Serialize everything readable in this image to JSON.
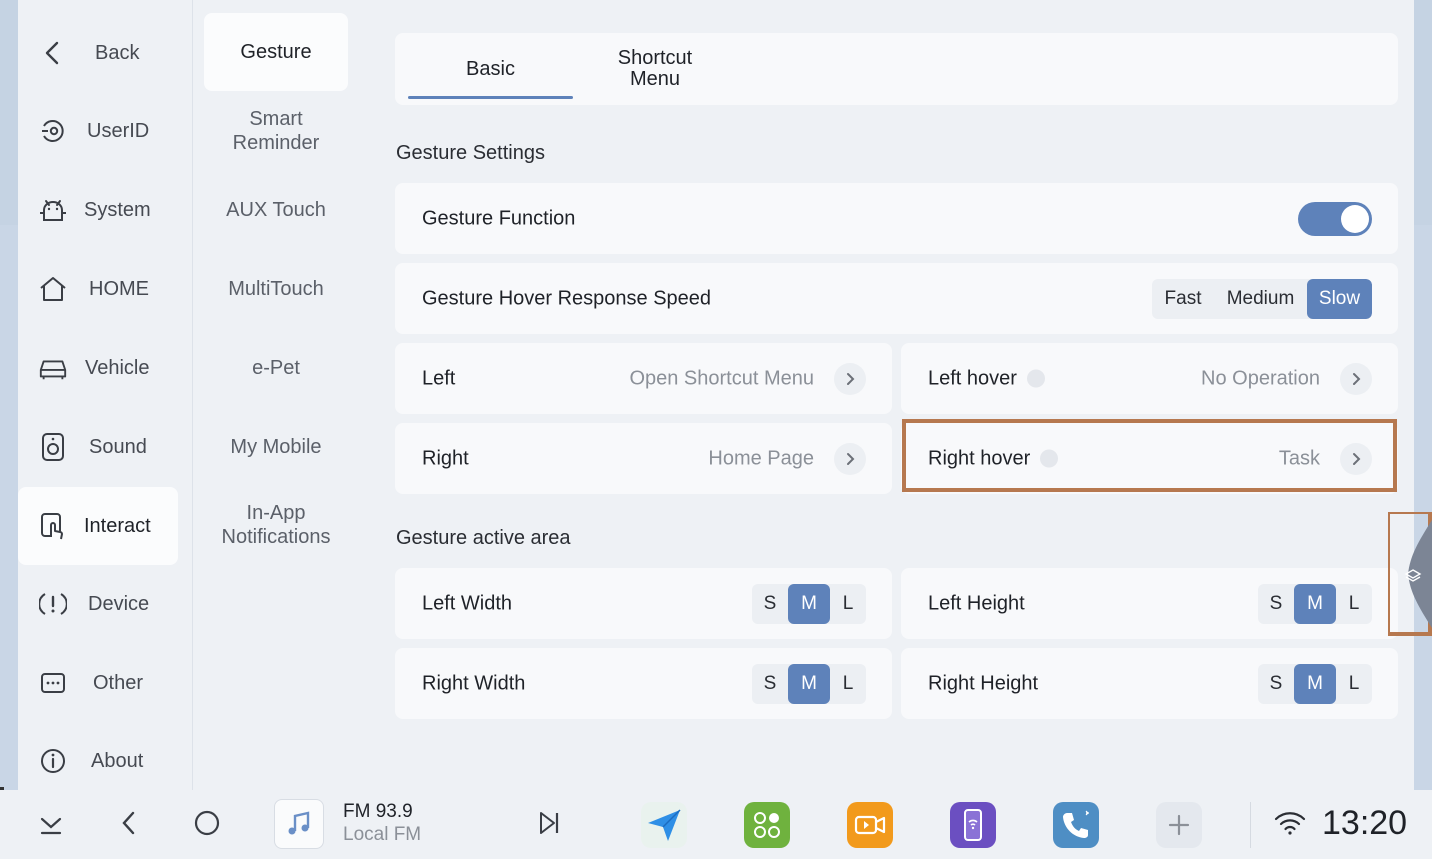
{
  "nav": {
    "back_label": "Back",
    "items": [
      {
        "label": "UserID",
        "icon": "user-id-icon"
      },
      {
        "label": "System",
        "icon": "android-icon"
      },
      {
        "label": "HOME",
        "icon": "home-icon"
      },
      {
        "label": "Vehicle",
        "icon": "car-icon"
      },
      {
        "label": "Sound",
        "icon": "speaker-icon"
      },
      {
        "label": "Interact",
        "icon": "touch-icon"
      },
      {
        "label": "Device",
        "icon": "device-alert-icon"
      },
      {
        "label": "Other",
        "icon": "more-icon"
      },
      {
        "label": "About",
        "icon": "info-icon"
      }
    ],
    "active": "Interact"
  },
  "subnav": {
    "items": [
      "Gesture",
      "Smart\nReminder",
      "AUX Touch",
      "MultiTouch",
      "e-Pet",
      "My Mobile",
      "In-App\nNotifications"
    ],
    "active": "Gesture"
  },
  "tabs": {
    "basic": "Basic",
    "shortcut_line1": "Shortcut",
    "shortcut_line2": "Menu",
    "active": "Basic"
  },
  "gesture_settings": {
    "title": "Gesture Settings",
    "function_label": "Gesture Function",
    "function_on": true,
    "hover_speed_label": "Gesture Hover Response Speed",
    "hover_speed_options": [
      "Fast",
      "Medium",
      "Slow"
    ],
    "hover_speed_selected": "Slow",
    "left_label": "Left",
    "left_value": "Open Shortcut Menu",
    "left_hover_label": "Left hover",
    "left_hover_value": "No Operation",
    "right_label": "Right",
    "right_value": "Home Page",
    "right_hover_label": "Right hover",
    "right_hover_value": "Task"
  },
  "active_area": {
    "title": "Gesture active area",
    "size_options": [
      "S",
      "M",
      "L"
    ],
    "left_width_label": "Left Width",
    "left_width": "M",
    "left_height_label": "Left Height",
    "left_height": "M",
    "right_width_label": "Right Width",
    "right_width": "M",
    "right_height_label": "Right Height",
    "right_height": "M"
  },
  "taskbar": {
    "media_title": "FM 93.9",
    "media_sub": "Local FM",
    "clock": "13:20",
    "dock_apps": [
      "navigation-app-icon",
      "apps-grid-icon",
      "video-app-icon",
      "phone-mirror-icon",
      "phone-call-icon",
      "add-icon"
    ]
  },
  "colors": {
    "accent": "#5e82ba",
    "highlight_border": "#b6784f",
    "background": "#eef1f5",
    "card": "#f8f9fb"
  }
}
